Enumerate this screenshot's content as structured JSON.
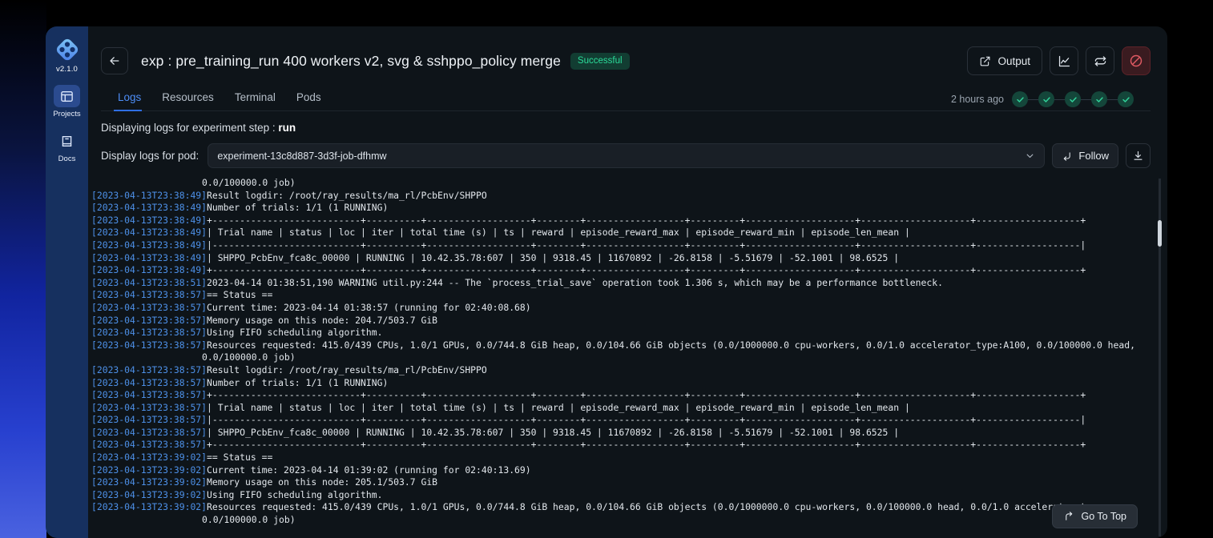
{
  "sidebar": {
    "logo_icon": "diamond-cluster-logo",
    "version": "v2.1.0",
    "items": [
      {
        "label": "Projects",
        "icon": "layout-panel-icon",
        "active": true
      },
      {
        "label": "Docs",
        "icon": "book-icon",
        "active": false
      }
    ]
  },
  "header": {
    "back_icon": "arrow-left-icon",
    "title": "exp : pre_training_run 400 workers v2, svg & sshppo_policy merge",
    "status_badge": "Successful",
    "status_badge_color": "#2bdc9a",
    "output_label": "Output",
    "output_icon": "external-link-icon",
    "metrics_icon": "line-chart-icon",
    "refresh_icon": "refresh-icon",
    "stop_icon": "no-entry-icon"
  },
  "tabs": [
    {
      "label": "Logs",
      "active": true
    },
    {
      "label": "Resources",
      "active": false
    },
    {
      "label": "Terminal",
      "active": false
    },
    {
      "label": "Pods",
      "active": false
    }
  ],
  "timeline": {
    "ago": "2 hours ago",
    "steps": [
      {
        "state": "check"
      },
      {
        "state": "check"
      },
      {
        "state": "check"
      },
      {
        "state": "check"
      },
      {
        "state": "check"
      }
    ]
  },
  "info": {
    "step_prefix": "Displaying logs for experiment step :",
    "step_name": "run",
    "pod_label": "Display logs for pod:",
    "pod_value": "experiment-13c8d887-3d3f-job-dfhmw",
    "pod_chevron_icon": "chevron-down-icon",
    "follow_label": "Follow",
    "follow_icon": "follow-arrow-icon",
    "download_icon": "download-icon"
  },
  "go_to_top": {
    "label": "Go To Top",
    "icon": "arrow-up-curve-icon"
  },
  "logs": [
    {
      "ts": "",
      "msg": "0.0/100000.0 job)"
    },
    {
      "ts": "[2023-04-13T23:38:49]",
      "msg": "Result logdir: /root/ray_results/ma_rl/PcbEnv/SHPPO"
    },
    {
      "ts": "[2023-04-13T23:38:49]",
      "msg": "Number of trials: 1/1 (1 RUNNING)"
    },
    {
      "ts": "[2023-04-13T23:38:49]",
      "msg": "+---------------------------+----------+-------------------+--------+------------------+---------+--------------------+--------------------+-------------------+"
    },
    {
      "ts": "[2023-04-13T23:38:49]",
      "msg": "| Trial name | status | loc | iter | total time (s) | ts | reward | episode_reward_max | episode_reward_min | episode_len_mean |"
    },
    {
      "ts": "[2023-04-13T23:38:49]",
      "msg": "|---------------------------+----------+-------------------+--------+------------------+---------+--------------------+--------------------+-------------------|"
    },
    {
      "ts": "[2023-04-13T23:38:49]",
      "msg": "| SHPPO_PcbEnv_fca8c_00000 | RUNNING | 10.42.35.78:607 | 350 | 9318.45 | 11670892 | -26.8158 | -5.51679 | -52.1001 | 98.6525 |"
    },
    {
      "ts": "[2023-04-13T23:38:49]",
      "msg": "+---------------------------+----------+-------------------+--------+------------------+---------+--------------------+--------------------+-------------------+"
    },
    {
      "ts": "[2023-04-13T23:38:51]",
      "msg": "2023-04-14 01:38:51,190 WARNING util.py:244 -- The `process_trial_save` operation took 1.306 s, which may be a performance bottleneck."
    },
    {
      "ts": "[2023-04-13T23:38:57]",
      "msg": "== Status =="
    },
    {
      "ts": "[2023-04-13T23:38:57]",
      "msg": "Current time: 2023-04-14 01:38:57 (running for 02:40:08.68)"
    },
    {
      "ts": "[2023-04-13T23:38:57]",
      "msg": "Memory usage on this node: 204.7/503.7 GiB"
    },
    {
      "ts": "[2023-04-13T23:38:57]",
      "msg": "Using FIFO scheduling algorithm."
    },
    {
      "ts": "[2023-04-13T23:38:57]",
      "msg": "Resources requested: 415.0/439 CPUs, 1.0/1 GPUs, 0.0/744.8 GiB heap, 0.0/104.66 GiB objects (0.0/1000000.0 cpu-workers, 0.0/1.0 accelerator_type:A100, 0.0/100000.0 head,"
    },
    {
      "ts": "",
      "msg": "0.0/100000.0 job)"
    },
    {
      "ts": "[2023-04-13T23:38:57]",
      "msg": "Result logdir: /root/ray_results/ma_rl/PcbEnv/SHPPO"
    },
    {
      "ts": "[2023-04-13T23:38:57]",
      "msg": "Number of trials: 1/1 (1 RUNNING)"
    },
    {
      "ts": "[2023-04-13T23:38:57]",
      "msg": "+---------------------------+----------+-------------------+--------+------------------+---------+--------------------+--------------------+-------------------+"
    },
    {
      "ts": "[2023-04-13T23:38:57]",
      "msg": "| Trial name | status | loc | iter | total time (s) | ts | reward | episode_reward_max | episode_reward_min | episode_len_mean |"
    },
    {
      "ts": "[2023-04-13T23:38:57]",
      "msg": "|---------------------------+----------+-------------------+--------+------------------+---------+--------------------+--------------------+-------------------|"
    },
    {
      "ts": "[2023-04-13T23:38:57]",
      "msg": "| SHPPO_PcbEnv_fca8c_00000 | RUNNING | 10.42.35.78:607 | 350 | 9318.45 | 11670892 | -26.8158 | -5.51679 | -52.1001 | 98.6525 |"
    },
    {
      "ts": "[2023-04-13T23:38:57]",
      "msg": "+---------------------------+----------+-------------------+--------+------------------+---------+--------------------+--------------------+-------------------+"
    },
    {
      "ts": "[2023-04-13T23:39:02]",
      "msg": "== Status =="
    },
    {
      "ts": "[2023-04-13T23:39:02]",
      "msg": "Current time: 2023-04-14 01:39:02 (running for 02:40:13.69)"
    },
    {
      "ts": "[2023-04-13T23:39:02]",
      "msg": "Memory usage on this node: 205.1/503.7 GiB"
    },
    {
      "ts": "[2023-04-13T23:39:02]",
      "msg": "Using FIFO scheduling algorithm."
    },
    {
      "ts": "[2023-04-13T23:39:02]",
      "msg": "Resources requested: 415.0/439 CPUs, 1.0/1 GPUs, 0.0/744.8 GiB heap, 0.0/104.66 GiB objects (0.0/1000000.0 cpu-workers, 0.0/100000.0 head, 0.0/1.0 accelerator_t"
    },
    {
      "ts": "",
      "msg": "0.0/100000.0 job)"
    }
  ]
}
